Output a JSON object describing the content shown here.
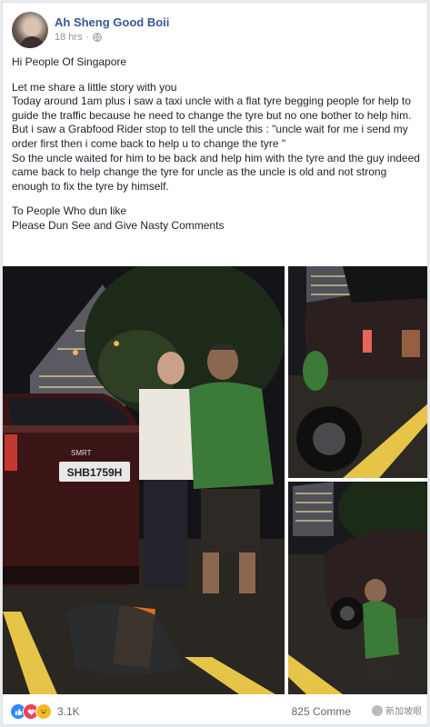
{
  "post": {
    "author": "Ah Sheng Good Boii",
    "time": "18 hrs",
    "privacy_icon": "globe-icon",
    "lines": [
      "Hi People Of Singapore",
      "Let me share a little story with you",
      "Today around 1am plus i saw a taxi uncle with a flat tyre begging people for help to guide the traffic because he need to change the tyre but no one bother to help him.",
      "But i saw a Grabfood Rider stop to tell the uncle this : \"uncle wait for me i send my order first then i come back to help u to change the tyre \"",
      "So the uncle waited for him to be back and help him with the tyre and the guy indeed came back to help change the tyre for uncle as the uncle is old and not strong enough to fix the tyre by himself.",
      "To People Who dun like",
      "Please Dun See and Give Nasty Comments"
    ]
  },
  "photos": {
    "main_plate": "SHB1759H",
    "plate_brand": "SMRT"
  },
  "footer": {
    "reaction_icons": [
      "like-icon",
      "love-icon",
      "haha-icon"
    ],
    "reaction_count": "3.1K",
    "comments": "825 Comme",
    "watermark": "新加坡眼"
  },
  "colors": {
    "name_blue": "#365899",
    "like_blue": "#2d88ff",
    "love_red": "#f33e58",
    "haha_yellow": "#f7b928",
    "vest_green": "#3c7a3a"
  }
}
